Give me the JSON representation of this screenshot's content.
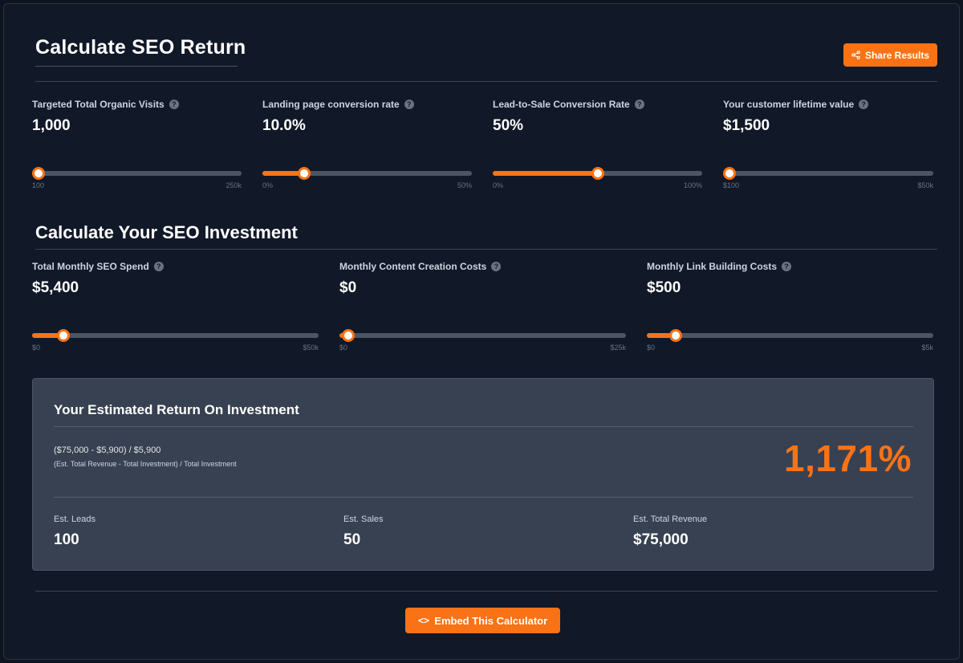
{
  "header": {
    "title": "Calculate SEO Return",
    "share_label": "Share Results"
  },
  "return_sliders": [
    {
      "label": "Targeted Total Organic Visits",
      "value": "1,000",
      "min": "100",
      "max": "250k",
      "percent": 0.004
    },
    {
      "label": "Landing page conversion rate",
      "value": "10.0%",
      "min": "0%",
      "max": "50%",
      "percent": 0.2
    },
    {
      "label": "Lead-to-Sale Conversion Rate",
      "value": "50%",
      "min": "0%",
      "max": "100%",
      "percent": 0.5
    },
    {
      "label": "Your customer lifetime value",
      "value": "$1,500",
      "min": "$100",
      "max": "$50k",
      "percent": 0.028
    }
  ],
  "investment": {
    "title": "Calculate Your SEO Investment",
    "sliders": [
      {
        "label": "Total Monthly SEO Spend",
        "value": "$5,400",
        "min": "$0",
        "max": "$50k",
        "percent": 0.108
      },
      {
        "label": "Monthly Content Creation Costs",
        "value": "$0",
        "min": "$0",
        "max": "$25k",
        "percent": 0.0
      },
      {
        "label": "Monthly Link Building Costs",
        "value": "$500",
        "min": "$0",
        "max": "$5k",
        "percent": 0.1
      }
    ]
  },
  "help_glyph": "?",
  "result": {
    "title": "Your Estimated Return On Investment",
    "formula": "($75,000 - $5,900) / $5,900",
    "formula_desc": "(Est. Total Revenue - Total Investment) / Total Investment",
    "roi": "1,171%",
    "stats": [
      {
        "label": "Est. Leads",
        "value": "100"
      },
      {
        "label": "Est. Sales",
        "value": "50"
      },
      {
        "label": "Est. Total Revenue",
        "value": "$75,000"
      }
    ]
  },
  "footer": {
    "embed_icon": "<>",
    "embed_label": "Embed This Calculator"
  },
  "colors": {
    "accent": "#f97316",
    "background": "#111827",
    "card": "#374151",
    "track": "#4b5563"
  },
  "icons": [
    "share-icon",
    "help-icon",
    "code-icon"
  ]
}
